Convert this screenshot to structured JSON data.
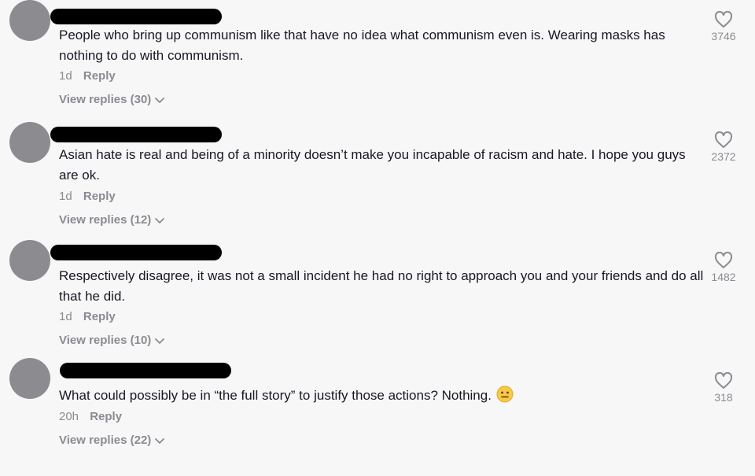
{
  "comments": [
    {
      "text": "People who bring up communism like that have no idea what communism even is. Wearing masks has nothing to do with communism.",
      "time": "1d",
      "reply_label": "Reply",
      "view_replies": "View replies (30)",
      "likes": "3746"
    },
    {
      "text": "Asian hate is real and being of a minority doesn’t make you incapable of racism and hate. I hope you guys are ok.",
      "time": "1d",
      "reply_label": "Reply",
      "view_replies": "View replies (12)",
      "likes": "2372"
    },
    {
      "text": "Respectively disagree, it was not a small incident he had no right to approach you and your friends and do all that he did.",
      "time": "1d",
      "reply_label": "Reply",
      "view_replies": "View replies (10)",
      "likes": "1482"
    },
    {
      "text": "What could possibly be in “the full story” to justify those actions? Nothing.",
      "time": "20h",
      "reply_label": "Reply",
      "view_replies": "View replies (22)",
      "likes": "318",
      "emoji": "neutral-face-emoji"
    }
  ],
  "icons": {
    "like": "heart-outline-icon",
    "expand": "chevron-down-icon"
  },
  "colors": {
    "background": "#f7f7f7",
    "text": "#161823",
    "muted": "#8a8b91",
    "avatar": "#8b8b90",
    "redaction": "#000000",
    "emoji": "#f7c948"
  }
}
